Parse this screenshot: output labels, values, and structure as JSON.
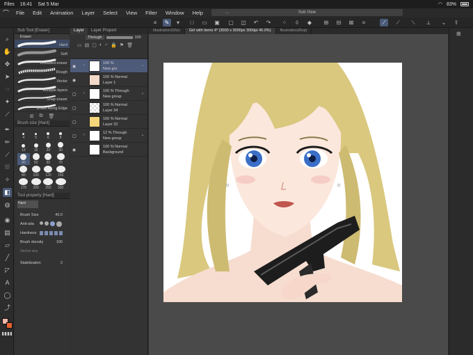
{
  "status": {
    "carrier": "Files",
    "time": "16:41",
    "date": "Sat 5 Mar",
    "battery": "83%"
  },
  "menu": [
    "File",
    "Edit",
    "Animation",
    "Layer",
    "Select",
    "View",
    "Filter",
    "Window",
    "Help"
  ],
  "subview": {
    "label": "Sub View",
    "dots": "..."
  },
  "subtool": {
    "title": "Sub Tool [Eraser]",
    "group": "Eraser",
    "items": [
      {
        "label": "Hard",
        "selected": true
      },
      {
        "label": "Soft",
        "selected": false
      },
      {
        "label": "Kneaded eraser",
        "selected": false
      },
      {
        "label": "Rough",
        "selected": false
      },
      {
        "label": "Vector",
        "selected": false
      },
      {
        "label": "Multiple layers",
        "selected": false
      },
      {
        "label": "Snap eraser",
        "selected": false
      },
      {
        "label": "Erase Along Edge",
        "selected": false
      }
    ]
  },
  "brushsize": {
    "title": "Brush size [Hard]",
    "sizes": [
      "4",
      "5",
      "6",
      "8",
      "12",
      "15",
      "20",
      "30",
      "40",
      "50",
      "60",
      "70",
      "80",
      "100",
      "120",
      "150",
      "170",
      "200",
      "250",
      "300"
    ],
    "selected": "40"
  },
  "toolprop": {
    "title": "Tool property [Hard]",
    "preset": "Hard",
    "brush_size_label": "Brush Size",
    "brush_size_value": "40.0",
    "antialias_label": "Anti-alia",
    "hardness_label": "Hardness",
    "brush_density_label": "Brush density",
    "brush_density_value": "100",
    "vector_label": "Vector era",
    "stabilization_label": "Stabilization",
    "stabilization_value": "2"
  },
  "layerpanel": {
    "tabs": [
      "Layer",
      "Layer Propert"
    ],
    "blend_mode": "Through",
    "opacity": "100",
    "layers": [
      {
        "pct": "100 %",
        "mode": "",
        "name": "New gro",
        "type": "group",
        "selected": true,
        "visible": true
      },
      {
        "pct": "100 %",
        "mode": "Normal",
        "name": "Layer 1",
        "type": "art",
        "selected": false,
        "visible": true
      },
      {
        "pct": "100 %",
        "mode": "Through",
        "name": "New group",
        "type": "group",
        "selected": false,
        "visible": false
      },
      {
        "pct": "100 %",
        "mode": "Normal",
        "name": "Layer 34",
        "type": "checker",
        "selected": false,
        "visible": false
      },
      {
        "pct": "100 %",
        "mode": "Normal",
        "name": "Layer 32",
        "type": "yellow",
        "selected": false,
        "visible": false
      },
      {
        "pct": "12 %",
        "mode": "Through",
        "name": "New group",
        "type": "group",
        "selected": false,
        "visible": false
      },
      {
        "pct": "100 %",
        "mode": "Normal",
        "name": "Background",
        "type": "white",
        "selected": false,
        "visible": true
      }
    ]
  },
  "doctabs": [
    {
      "label": "Illustration2(Re)",
      "active": false
    },
    {
      "label": "Girl with items 4* (3000 x 3000px 300dpi 46.0%)",
      "active": true
    },
    {
      "label": "Illustration(Rep)",
      "active": false
    }
  ],
  "colors": {
    "main": "#f0b8a8",
    "sub": "#e8622e",
    "accent": "#4a5a78"
  }
}
